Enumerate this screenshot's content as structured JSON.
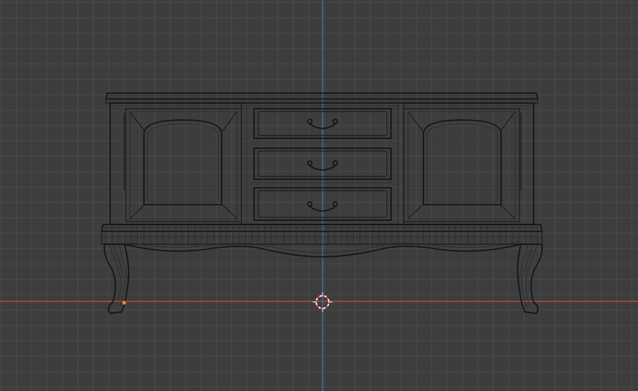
{
  "viewport": {
    "view": "front-orthographic",
    "mode": "wireframe",
    "background_color": "#3d3d3d",
    "grid_color": "#4a4a4a",
    "x_axis_color": "#c84b4b",
    "z_axis_color": "#3f7fb3"
  },
  "scene": {
    "object": "sideboard-cabinet",
    "wire_color": "#1a1a1a",
    "origin_color": "#f08a24",
    "cursor_colors": [
      "#ff3b3b",
      "#ffffff"
    ],
    "drawer_count": 3,
    "door_count": 2,
    "leg_count": 2
  }
}
